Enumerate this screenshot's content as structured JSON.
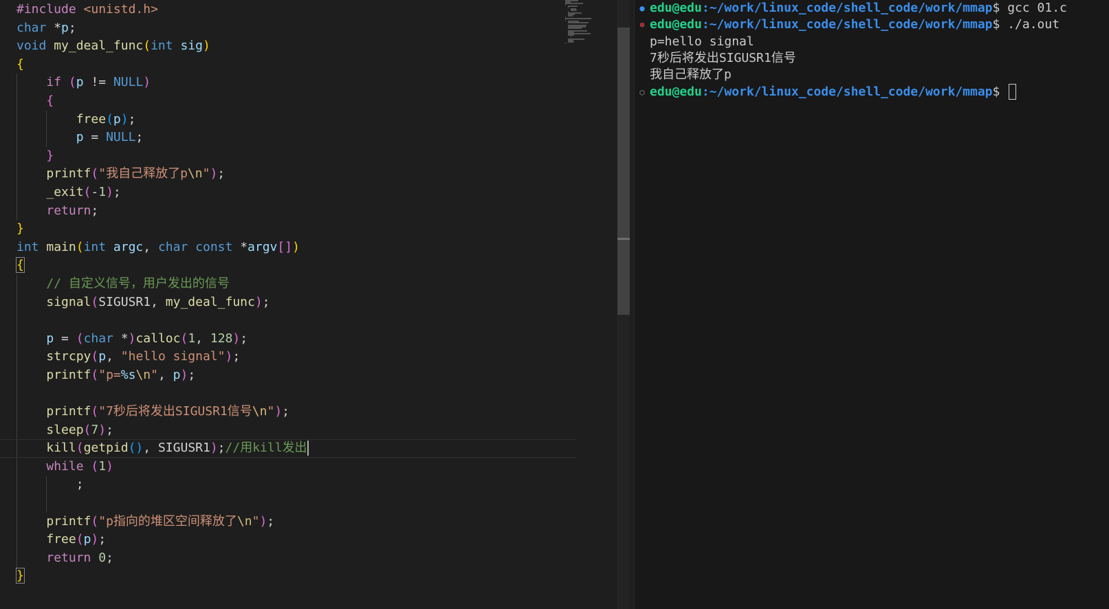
{
  "editor": {
    "lines": [
      [
        {
          "t": "#include ",
          "c": "pre"
        },
        {
          "t": "<unistd.h>",
          "c": "str"
        }
      ],
      [
        {
          "t": "char",
          "c": "kw"
        },
        {
          "t": " *",
          "c": "plain"
        },
        {
          "t": "p",
          "c": "var"
        },
        {
          "t": ";",
          "c": "plain"
        }
      ],
      [
        {
          "t": "void",
          "c": "kw"
        },
        {
          "t": " ",
          "c": "plain"
        },
        {
          "t": "my_deal_func",
          "c": "fn"
        },
        {
          "t": "(",
          "c": "b1"
        },
        {
          "t": "int",
          "c": "kw"
        },
        {
          "t": " ",
          "c": "plain"
        },
        {
          "t": "sig",
          "c": "var"
        },
        {
          "t": ")",
          "c": "b1"
        }
      ],
      [
        {
          "t": "{",
          "c": "b1"
        }
      ],
      [
        {
          "t": "    ",
          "c": "plain"
        },
        {
          "t": "if",
          "c": "ctl"
        },
        {
          "t": " ",
          "c": "plain"
        },
        {
          "t": "(",
          "c": "b2"
        },
        {
          "t": "p",
          "c": "var"
        },
        {
          "t": " != ",
          "c": "plain"
        },
        {
          "t": "NULL",
          "c": "mac"
        },
        {
          "t": ")",
          "c": "b2"
        }
      ],
      [
        {
          "t": "    ",
          "c": "plain"
        },
        {
          "t": "{",
          "c": "b2"
        }
      ],
      [
        {
          "t": "        ",
          "c": "plain"
        },
        {
          "t": "free",
          "c": "fn"
        },
        {
          "t": "(",
          "c": "b3"
        },
        {
          "t": "p",
          "c": "var"
        },
        {
          "t": ")",
          "c": "b3"
        },
        {
          "t": ";",
          "c": "plain"
        }
      ],
      [
        {
          "t": "        ",
          "c": "plain"
        },
        {
          "t": "p",
          "c": "var"
        },
        {
          "t": " = ",
          "c": "plain"
        },
        {
          "t": "NULL",
          "c": "mac"
        },
        {
          "t": ";",
          "c": "plain"
        }
      ],
      [
        {
          "t": "    ",
          "c": "plain"
        },
        {
          "t": "}",
          "c": "b2"
        }
      ],
      [
        {
          "t": "    ",
          "c": "plain"
        },
        {
          "t": "printf",
          "c": "fn"
        },
        {
          "t": "(",
          "c": "b2"
        },
        {
          "t": "\"我自己释放了p",
          "c": "str"
        },
        {
          "t": "\\n",
          "c": "esc"
        },
        {
          "t": "\"",
          "c": "str"
        },
        {
          "t": ")",
          "c": "b2"
        },
        {
          "t": ";",
          "c": "plain"
        }
      ],
      [
        {
          "t": "    ",
          "c": "plain"
        },
        {
          "t": "_exit",
          "c": "fn"
        },
        {
          "t": "(",
          "c": "b2"
        },
        {
          "t": "-",
          "c": "plain"
        },
        {
          "t": "1",
          "c": "num"
        },
        {
          "t": ")",
          "c": "b2"
        },
        {
          "t": ";",
          "c": "plain"
        }
      ],
      [
        {
          "t": "    ",
          "c": "plain"
        },
        {
          "t": "return",
          "c": "ctl"
        },
        {
          "t": ";",
          "c": "plain"
        }
      ],
      [
        {
          "t": "}",
          "c": "b1"
        }
      ],
      [
        {
          "t": "int",
          "c": "kw"
        },
        {
          "t": " ",
          "c": "plain"
        },
        {
          "t": "main",
          "c": "fn"
        },
        {
          "t": "(",
          "c": "b1"
        },
        {
          "t": "int",
          "c": "kw"
        },
        {
          "t": " ",
          "c": "plain"
        },
        {
          "t": "argc",
          "c": "var"
        },
        {
          "t": ", ",
          "c": "plain"
        },
        {
          "t": "char",
          "c": "kw"
        },
        {
          "t": " ",
          "c": "plain"
        },
        {
          "t": "const",
          "c": "kw"
        },
        {
          "t": " *",
          "c": "plain"
        },
        {
          "t": "argv",
          "c": "var"
        },
        {
          "t": "[]",
          "c": "b2"
        },
        {
          "t": ")",
          "c": "b1"
        }
      ],
      [
        {
          "t": "{",
          "c": "b1 bm"
        }
      ],
      [
        {
          "t": "    ",
          "c": "plain"
        },
        {
          "t": "// 自定义信号，用户发出的信号",
          "c": "cmt"
        }
      ],
      [
        {
          "t": "    ",
          "c": "plain"
        },
        {
          "t": "signal",
          "c": "fn"
        },
        {
          "t": "(",
          "c": "b2"
        },
        {
          "t": "SIGUSR1",
          "c": "plain"
        },
        {
          "t": ", ",
          "c": "plain"
        },
        {
          "t": "my_deal_func",
          "c": "fn"
        },
        {
          "t": ")",
          "c": "b2"
        },
        {
          "t": ";",
          "c": "plain"
        }
      ],
      [],
      [
        {
          "t": "    ",
          "c": "plain"
        },
        {
          "t": "p",
          "c": "var"
        },
        {
          "t": " = ",
          "c": "plain"
        },
        {
          "t": "(",
          "c": "b2"
        },
        {
          "t": "char",
          "c": "kw"
        },
        {
          "t": " *",
          "c": "plain"
        },
        {
          "t": ")",
          "c": "b2"
        },
        {
          "t": "calloc",
          "c": "fn"
        },
        {
          "t": "(",
          "c": "b2"
        },
        {
          "t": "1",
          "c": "num"
        },
        {
          "t": ", ",
          "c": "plain"
        },
        {
          "t": "128",
          "c": "num"
        },
        {
          "t": ")",
          "c": "b2"
        },
        {
          "t": ";",
          "c": "plain"
        }
      ],
      [
        {
          "t": "    ",
          "c": "plain"
        },
        {
          "t": "strcpy",
          "c": "fn"
        },
        {
          "t": "(",
          "c": "b2"
        },
        {
          "t": "p",
          "c": "var"
        },
        {
          "t": ", ",
          "c": "plain"
        },
        {
          "t": "\"hello signal\"",
          "c": "str"
        },
        {
          "t": ")",
          "c": "b2"
        },
        {
          "t": ";",
          "c": "plain"
        }
      ],
      [
        {
          "t": "    ",
          "c": "plain"
        },
        {
          "t": "printf",
          "c": "fn"
        },
        {
          "t": "(",
          "c": "b2"
        },
        {
          "t": "\"p=",
          "c": "str"
        },
        {
          "t": "%s",
          "c": "var"
        },
        {
          "t": "\\n",
          "c": "esc"
        },
        {
          "t": "\"",
          "c": "str"
        },
        {
          "t": ", ",
          "c": "plain"
        },
        {
          "t": "p",
          "c": "var"
        },
        {
          "t": ")",
          "c": "b2"
        },
        {
          "t": ";",
          "c": "plain"
        }
      ],
      [],
      [
        {
          "t": "    ",
          "c": "plain"
        },
        {
          "t": "printf",
          "c": "fn"
        },
        {
          "t": "(",
          "c": "b2"
        },
        {
          "t": "\"7秒后将发出SIGUSR1信号",
          "c": "str"
        },
        {
          "t": "\\n",
          "c": "esc"
        },
        {
          "t": "\"",
          "c": "str"
        },
        {
          "t": ")",
          "c": "b2"
        },
        {
          "t": ";",
          "c": "plain"
        }
      ],
      [
        {
          "t": "    ",
          "c": "plain"
        },
        {
          "t": "sleep",
          "c": "fn"
        },
        {
          "t": "(",
          "c": "b2"
        },
        {
          "t": "7",
          "c": "num"
        },
        {
          "t": ")",
          "c": "b2"
        },
        {
          "t": ";",
          "c": "plain"
        }
      ],
      [
        {
          "t": "    ",
          "c": "plain"
        },
        {
          "t": "kill",
          "c": "fn"
        },
        {
          "t": "(",
          "c": "b2"
        },
        {
          "t": "getpid",
          "c": "fn"
        },
        {
          "t": "()",
          "c": "b3"
        },
        {
          "t": ", ",
          "c": "plain"
        },
        {
          "t": "SIGUSR1",
          "c": "plain"
        },
        {
          "t": ")",
          "c": "b2"
        },
        {
          "t": ";",
          "c": "plain"
        },
        {
          "t": "//用kill发出",
          "c": "cmt"
        }
      ],
      [
        {
          "t": "    ",
          "c": "plain"
        },
        {
          "t": "while",
          "c": "ctl"
        },
        {
          "t": " ",
          "c": "plain"
        },
        {
          "t": "(",
          "c": "b2"
        },
        {
          "t": "1",
          "c": "num"
        },
        {
          "t": ")",
          "c": "b2"
        }
      ],
      [
        {
          "t": "        ",
          "c": "plain"
        },
        {
          "t": ";",
          "c": "plain"
        }
      ],
      [],
      [
        {
          "t": "    ",
          "c": "plain"
        },
        {
          "t": "printf",
          "c": "fn"
        },
        {
          "t": "(",
          "c": "b2"
        },
        {
          "t": "\"p指向的堆区空间释放了",
          "c": "str"
        },
        {
          "t": "\\n",
          "c": "esc"
        },
        {
          "t": "\"",
          "c": "str"
        },
        {
          "t": ")",
          "c": "b2"
        },
        {
          "t": ";",
          "c": "plain"
        }
      ],
      [
        {
          "t": "    ",
          "c": "plain"
        },
        {
          "t": "free",
          "c": "fn"
        },
        {
          "t": "(",
          "c": "b2"
        },
        {
          "t": "p",
          "c": "var"
        },
        {
          "t": ")",
          "c": "b2"
        },
        {
          "t": ";",
          "c": "plain"
        }
      ],
      [
        {
          "t": "    ",
          "c": "plain"
        },
        {
          "t": "return",
          "c": "ctl"
        },
        {
          "t": " ",
          "c": "plain"
        },
        {
          "t": "0",
          "c": "num"
        },
        {
          "t": ";",
          "c": "plain"
        }
      ],
      [
        {
          "t": "}",
          "c": "b1 bm"
        }
      ]
    ],
    "current_line": 24
  },
  "terminal": {
    "lines": [
      {
        "status": "success",
        "icon": "●",
        "user": "edu@edu",
        "path": ":~/work/linux_code/shell_code/work/mmap",
        "prompt": "$ ",
        "cmd": "gcc 01.c"
      },
      {
        "status": "error",
        "icon": "⊗",
        "user": "edu@edu",
        "path": ":~/work/linux_code/shell_code/work/mmap",
        "prompt": "$ ",
        "cmd": "./a.out"
      },
      {
        "output": "p=hello signal"
      },
      {
        "output": "7秒后将发出SIGUSR1信号"
      },
      {
        "output": "我自己释放了p"
      },
      {
        "status": "none",
        "icon": "○",
        "user": "edu@edu",
        "path": ":~/work/linux_code/shell_code/work/mmap",
        "prompt": "$ ",
        "cmd": "",
        "cursor": true
      }
    ]
  },
  "colors": {
    "editor_bg": "#1e1e1e",
    "terminal_bg": "#181818",
    "prompt_user": "#23d18b",
    "prompt_path": "#3b8eea"
  }
}
